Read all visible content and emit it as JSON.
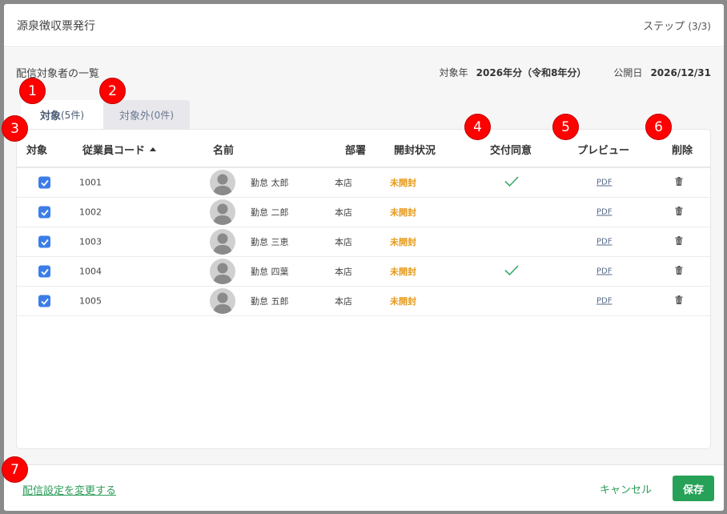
{
  "modal": {
    "title": "源泉徴収票発行",
    "step_label": "ステップ",
    "step_count": "(3/3)"
  },
  "body": {
    "list_title": "配信対象者の一覧",
    "target_year_label": "対象年",
    "target_year_value": "2026年分（令和8年分）",
    "publish_date_label": "公開日",
    "publish_date_value": "2026/12/31"
  },
  "tabs": [
    {
      "label": "対象",
      "count": "(5件)",
      "active": true
    },
    {
      "label": "対象外",
      "count": "(0件)",
      "active": false
    }
  ],
  "table": {
    "headers": {
      "target": "対象",
      "code": "従業員コード",
      "name": "名前",
      "department": "部署",
      "open_status": "開封状況",
      "consent": "交付同意",
      "preview": "プレビュー",
      "delete": "削除"
    },
    "rows": [
      {
        "checked": true,
        "code": "1001",
        "name": "勤怠 太郎",
        "department": "本店",
        "status": "未開封",
        "consent": true,
        "preview": "PDF"
      },
      {
        "checked": true,
        "code": "1002",
        "name": "勤怠 二郎",
        "department": "本店",
        "status": "未開封",
        "consent": false,
        "preview": "PDF"
      },
      {
        "checked": true,
        "code": "1003",
        "name": "勤怠 三恵",
        "department": "本店",
        "status": "未開封",
        "consent": false,
        "preview": "PDF"
      },
      {
        "checked": true,
        "code": "1004",
        "name": "勤怠 四葉",
        "department": "本店",
        "status": "未開封",
        "consent": true,
        "preview": "PDF"
      },
      {
        "checked": true,
        "code": "1005",
        "name": "勤怠 五郎",
        "department": "本店",
        "status": "未開封",
        "consent": false,
        "preview": "PDF"
      }
    ]
  },
  "footer": {
    "change_settings_link": "配信設定を変更する",
    "cancel_label": "キャンセル",
    "save_label": "保存"
  },
  "markers": [
    "1",
    "2",
    "3",
    "4",
    "5",
    "6",
    "7"
  ],
  "colors": {
    "accent_green": "#26a157",
    "checkbox_blue": "#3b7ee8",
    "status_orange": "#e69a1a",
    "marker_red": "#ff0000"
  }
}
